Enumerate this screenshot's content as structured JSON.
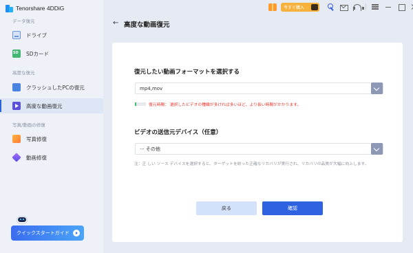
{
  "app": {
    "title": "Tenorshare 4DDiG"
  },
  "sidebar": {
    "sections": [
      {
        "label": "データ復元",
        "items": [
          {
            "label": "ドライブ",
            "icon": "drive-icon"
          },
          {
            "label": "SDカード",
            "icon": "sd-card-icon"
          }
        ]
      },
      {
        "label": "高度な復元",
        "items": [
          {
            "label": "クラッシュしたPCの復元",
            "icon": "crashed-pc-icon"
          },
          {
            "label": "高度な動画復元",
            "icon": "video-recovery-icon",
            "active": true
          }
        ]
      },
      {
        "label": "写真/動画の修復",
        "items": [
          {
            "label": "写真修復",
            "icon": "photo-repair-icon"
          },
          {
            "label": "動画修復",
            "icon": "video-repair-icon"
          }
        ]
      }
    ],
    "quick_start": "クイックスタートガイド"
  },
  "topbar": {
    "buy_label": "今すぐ購入"
  },
  "page": {
    "back_glyph": "←",
    "title": "高度な動画復元"
  },
  "format_section": {
    "heading": "復元したい動画フォーマットを選択する",
    "selected": "mp4,mov",
    "warning": "復元時間： 選択したビデオの種類が多ければ多いほど、より長い時間がかかります。",
    "time_level": 0.1
  },
  "device_section": {
    "heading": "ビデオの送信元デバイス（任意）",
    "selected": "··· その他",
    "note": "注：正 しい ソース デバイスを選択すると、ターゲットを絞った正確なリカバリが実行され、リカバリの品質が大幅に向上します。"
  },
  "buttons": {
    "back": "戻る",
    "confirm": "確認"
  },
  "colors": {
    "accent": "#2f62e0",
    "warning": "#e5352b",
    "sidebar_bg": "#eef2f8"
  }
}
